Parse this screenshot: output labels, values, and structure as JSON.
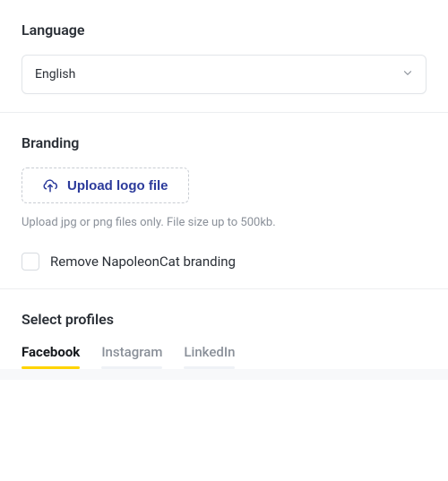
{
  "language": {
    "title": "Language",
    "selected": "English"
  },
  "branding": {
    "title": "Branding",
    "upload_label": "Upload logo file",
    "helper": "Upload jpg or png files only. File size up to 500kb.",
    "remove_label": "Remove NapoleonCat branding"
  },
  "profiles": {
    "title": "Select profiles",
    "tabs": [
      {
        "label": "Facebook",
        "active": true
      },
      {
        "label": "Instagram",
        "active": false
      },
      {
        "label": "LinkedIn",
        "active": false
      }
    ]
  }
}
